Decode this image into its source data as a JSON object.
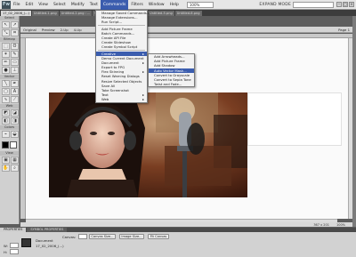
{
  "menubar": {
    "logo": "Fw",
    "items": [
      "File",
      "Edit",
      "View",
      "Select",
      "Modify",
      "Text",
      "Commands",
      "Filters",
      "Window",
      "Help"
    ],
    "active_index": 6,
    "zoom": "100%",
    "mode": "EXPAND MODE"
  },
  "tabs": [
    "17_02_2006_(...)",
    "Untitled-1.png",
    "Untitled-2.png : ...",
    "Untitled-3.png",
    "Untitled-4.png",
    "Untitled-5.png",
    "Untitled-6.png"
  ],
  "subbar": {
    "items": [
      "Original",
      "Preview",
      "2-Up",
      "4-Up",
      "Page 1"
    ]
  },
  "toolbox": {
    "sections": [
      "Select",
      "Bitmap",
      "Vector",
      "Web",
      "Colors",
      "View"
    ]
  },
  "commands_menu": {
    "items": [
      {
        "label": "Manage Saved Commands...",
        "submenu": false
      },
      {
        "label": "Manage Extensions...",
        "submenu": false
      },
      {
        "label": "Run Script...",
        "submenu": false
      },
      {
        "sep": true
      },
      {
        "label": "Add Picture Frame",
        "submenu": false
      },
      {
        "label": "Batch Commands...",
        "submenu": false
      },
      {
        "label": "Create API File",
        "submenu": false
      },
      {
        "label": "Create Slideshow",
        "submenu": false
      },
      {
        "label": "Create Symbol Script",
        "submenu": false
      },
      {
        "sep": true
      },
      {
        "label": "Creative",
        "submenu": true,
        "selected": true
      },
      {
        "label": "Demo Current Document",
        "submenu": false
      },
      {
        "label": "Document",
        "submenu": true
      },
      {
        "label": "Export to FPG",
        "submenu": false
      },
      {
        "label": "Flex Skinning",
        "submenu": true
      },
      {
        "label": "Reset Warning Dialogs",
        "submenu": false
      },
      {
        "label": "Resize Selected Objects",
        "submenu": false
      },
      {
        "label": "Save All",
        "submenu": false
      },
      {
        "label": "Take Screenshot",
        "submenu": false
      },
      {
        "label": "Text",
        "submenu": true
      },
      {
        "label": "Web",
        "submenu": true
      }
    ]
  },
  "creative_submenu": {
    "items": [
      {
        "label": "Add Arrowheads..."
      },
      {
        "label": "Add Picture Frame"
      },
      {
        "label": "Add Shadow"
      },
      {
        "label": "Auto Vector Mask...",
        "selected": true
      },
      {
        "label": "Convert to Grayscale"
      },
      {
        "label": "Convert to Sepia Tone"
      },
      {
        "label": "Twist and Fade..."
      }
    ]
  },
  "status": {
    "size": "367 x 201",
    "zoom": "100%"
  },
  "properties": {
    "tabs": [
      "PROPERTIES",
      "SYMBOL PROPERTIES"
    ],
    "doc_label": "Document",
    "doc_name": "17_02_2006_(...)",
    "width_label": "W:",
    "height_label": "H:",
    "canvas_label": "Canvas:",
    "canvas_size_btn": "Canvas Size...",
    "image_size_btn": "Image Size...",
    "fit_canvas_btn": "Fit Canvas"
  }
}
